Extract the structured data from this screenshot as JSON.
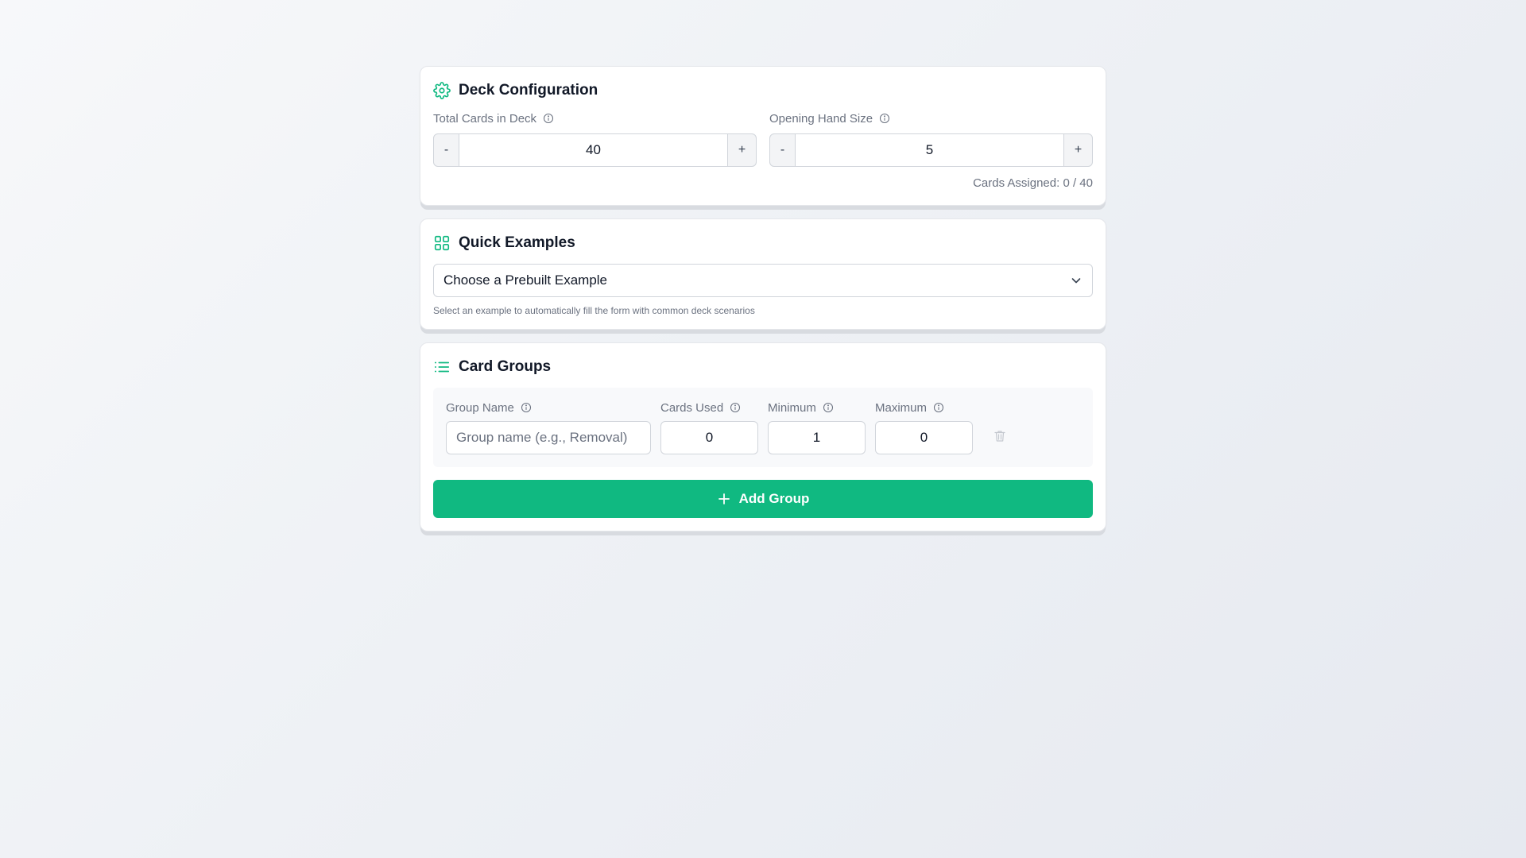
{
  "deck_config": {
    "title": "Deck Configuration",
    "total_cards": {
      "label": "Total Cards in Deck",
      "value": "40",
      "minus": "-",
      "plus": "+"
    },
    "hand_size": {
      "label": "Opening Hand Size",
      "value": "5",
      "minus": "-",
      "plus": "+"
    },
    "assigned_text": "Cards Assigned: 0 / 40"
  },
  "quick_examples": {
    "title": "Quick Examples",
    "select_value": "Choose a Prebuilt Example",
    "hint": "Select an example to automatically fill the form with common deck scenarios"
  },
  "card_groups": {
    "title": "Card Groups",
    "columns": {
      "group_name": "Group Name",
      "cards_used": "Cards Used",
      "minimum": "Minimum",
      "maximum": "Maximum"
    },
    "row": {
      "group_name_placeholder": "Group name (e.g., Removal)",
      "group_name_value": "",
      "cards_used": "0",
      "minimum": "1",
      "maximum": "0"
    },
    "add_label": "Add Group"
  },
  "icons": {
    "deck_config": "gear-icon",
    "quick_examples": "grid-icon",
    "card_groups": "list-icon",
    "info": "info-icon",
    "select": "chevron-down-icon",
    "delete": "trash-icon",
    "add": "plus-icon"
  },
  "colors": {
    "accent": "#10b981",
    "muted_text": "#6b7280",
    "border": "#d1d5db"
  }
}
